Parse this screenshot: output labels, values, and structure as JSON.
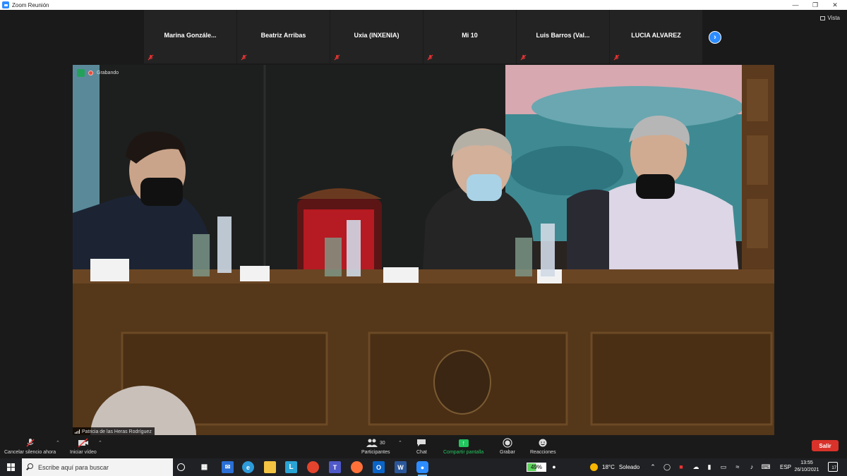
{
  "window": {
    "title": "Zoom Reunión",
    "vista_label": "Vista"
  },
  "participants_strip": [
    {
      "name": "Marina  Gonzále..."
    },
    {
      "name": "Beatriz Arribas"
    },
    {
      "name": "Uxia (INXENIA)"
    },
    {
      "name": "Mi 10"
    },
    {
      "name": "Luis Barros (Val..."
    },
    {
      "name": "LUCIA ALVAREZ"
    }
  ],
  "video": {
    "recording_label": "Grabando",
    "speaker_name": "Patricia de las Heras Rodríguez"
  },
  "toolbar": {
    "unmute": "Cancelar silencio ahora",
    "video": "Iniciar vídeo",
    "participants": "Participantes",
    "participants_count": "30",
    "chat": "Chat",
    "share": "Compartir pantalla",
    "record": "Grabar",
    "reactions": "Reacciones",
    "leave": "Salir"
  },
  "taskbar": {
    "search_placeholder": "Escribe aquí para buscar",
    "battery": "49%",
    "battery_level": 0.49,
    "weather_temp": "18°C",
    "weather_text": "Soleado",
    "language": "ESP",
    "time": "13:55",
    "date": "26/10/2021",
    "notifications": "17"
  },
  "colors": {
    "accent": "#2d8cff",
    "share_green": "#23c55e",
    "leave_red": "#d9322a",
    "recording_red": "#e84b3c"
  }
}
